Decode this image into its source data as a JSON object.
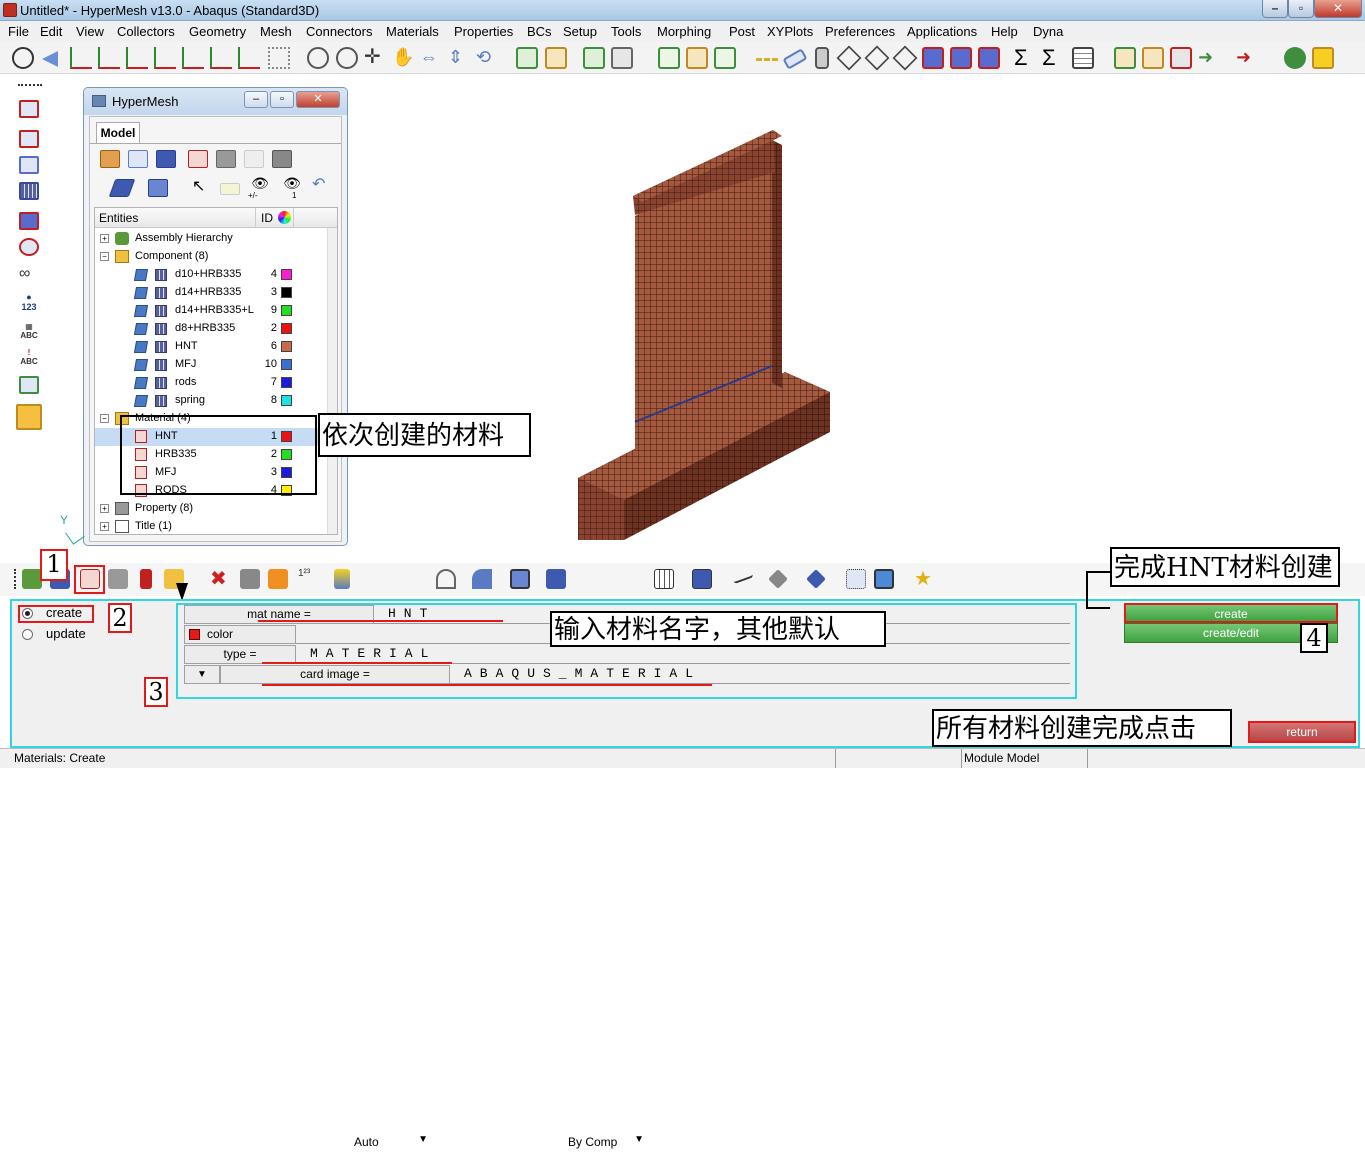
{
  "window": {
    "title": "Untitled* - HyperMesh v13.0 - Abaqus (Standard3D)"
  },
  "menu": [
    "File",
    "Edit",
    "View",
    "Collectors",
    "Geometry",
    "Mesh",
    "Connectors",
    "Materials",
    "Properties",
    "BCs",
    "Setup",
    "Tools",
    "Morphing",
    "Post",
    "XYPlots",
    "Preferences",
    "Applications",
    "Help",
    "Dyna"
  ],
  "left_toolbar": {
    "labels": [
      "123",
      "ABC",
      "ABC"
    ]
  },
  "hypermesh_panel": {
    "title": "HyperMesh",
    "tab": "Model",
    "view_labels": [
      "+/-",
      "1"
    ],
    "columns": {
      "entities": "Entities",
      "id": "ID"
    },
    "tree": {
      "assembly": "Assembly Hierarchy",
      "component_header": "Component (8)",
      "components": [
        {
          "name": "d10+HRB335",
          "id": "4",
          "color": "#ff1bd6"
        },
        {
          "name": "d14+HRB335",
          "id": "3",
          "color": "#000000"
        },
        {
          "name": "d14+HRB335+L",
          "id": "9",
          "color": "#22dd22"
        },
        {
          "name": "d8+HRB335",
          "id": "2",
          "color": "#ee1111"
        },
        {
          "name": "HNT",
          "id": "6",
          "color": "#c86a4a"
        },
        {
          "name": "MFJ",
          "id": "10",
          "color": "#3d6fd0"
        },
        {
          "name": "rods",
          "id": "7",
          "color": "#1a1adc"
        },
        {
          "name": "spring",
          "id": "8",
          "color": "#22e0e0"
        }
      ],
      "material_header": "Material (4)",
      "materials": [
        {
          "name": "HNT",
          "id": "1",
          "color": "#ee1111"
        },
        {
          "name": "HRB335",
          "id": "2",
          "color": "#22dd22"
        },
        {
          "name": "MFJ",
          "id": "3",
          "color": "#1a1adc"
        },
        {
          "name": "RODS",
          "id": "4",
          "color": "#ffee00"
        }
      ],
      "property": "Property (8)",
      "title_node": "Title (1)"
    }
  },
  "annotations": {
    "created_materials": "依次创建的材料",
    "hnt_done": "完成HNT材料创建",
    "enter_name": "输入材料名字，其他默认",
    "all_done": "所有材料创建完成点击",
    "steps": [
      "1",
      "2",
      "3",
      "4"
    ]
  },
  "axis": {
    "y_label": "Y"
  },
  "bottom_toolbar": {
    "display_mode": "Auto",
    "color_mode": "By Comp"
  },
  "panel": {
    "modes": {
      "create": "create",
      "update": "update",
      "selected": "create"
    },
    "fields": {
      "mat_name_label": "mat name =",
      "mat_name_value": "HNT",
      "color_label": "color",
      "type_label": "type =",
      "type_value": "MATERIAL",
      "card_image_label": "card image =",
      "card_image_value": "ABAQUS_MATERIAL"
    },
    "buttons": {
      "create": "create",
      "create_edit": "create/edit",
      "return": "return"
    }
  },
  "status": {
    "left": "Materials: Create",
    "module": "Module Model"
  }
}
